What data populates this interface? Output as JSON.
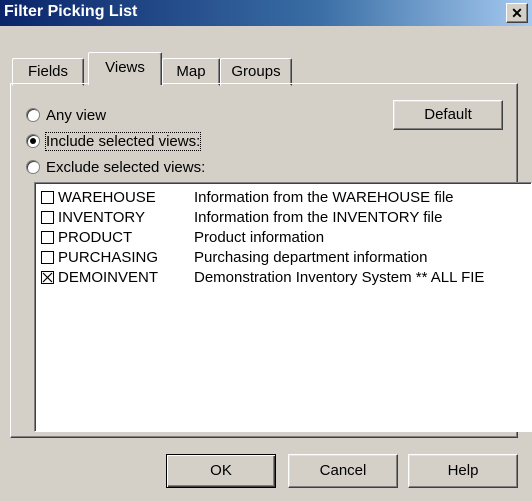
{
  "window": {
    "title": "Filter Picking List",
    "close_glyph": "✕"
  },
  "tabs": [
    {
      "label": "Fields",
      "active": false
    },
    {
      "label": "Views",
      "active": true
    },
    {
      "label": "Map",
      "active": false
    },
    {
      "label": "Groups",
      "active": false
    }
  ],
  "options": {
    "any_view": {
      "label": "Any view",
      "selected": false
    },
    "include_selected": {
      "label": "Include selected views:",
      "selected": true
    },
    "exclude_selected": {
      "label": "Exclude selected views:",
      "selected": false
    }
  },
  "default_button": "Default",
  "views": [
    {
      "name": "WAREHOUSE",
      "description": "Information from the WAREHOUSE file",
      "checked": false
    },
    {
      "name": "INVENTORY",
      "description": "Information from the INVENTORY file",
      "checked": false
    },
    {
      "name": "PRODUCT",
      "description": "Product information",
      "checked": false
    },
    {
      "name": "PURCHASING",
      "description": "Purchasing department information",
      "checked": false
    },
    {
      "name": "DEMOINVENT",
      "description": "Demonstration Inventory System  ** ALL FIE",
      "checked": true
    }
  ],
  "footer": {
    "ok": "OK",
    "cancel": "Cancel",
    "help": "Help"
  },
  "colors": {
    "titlebar_start": "#0a246a",
    "face": "#d4d0c8"
  }
}
